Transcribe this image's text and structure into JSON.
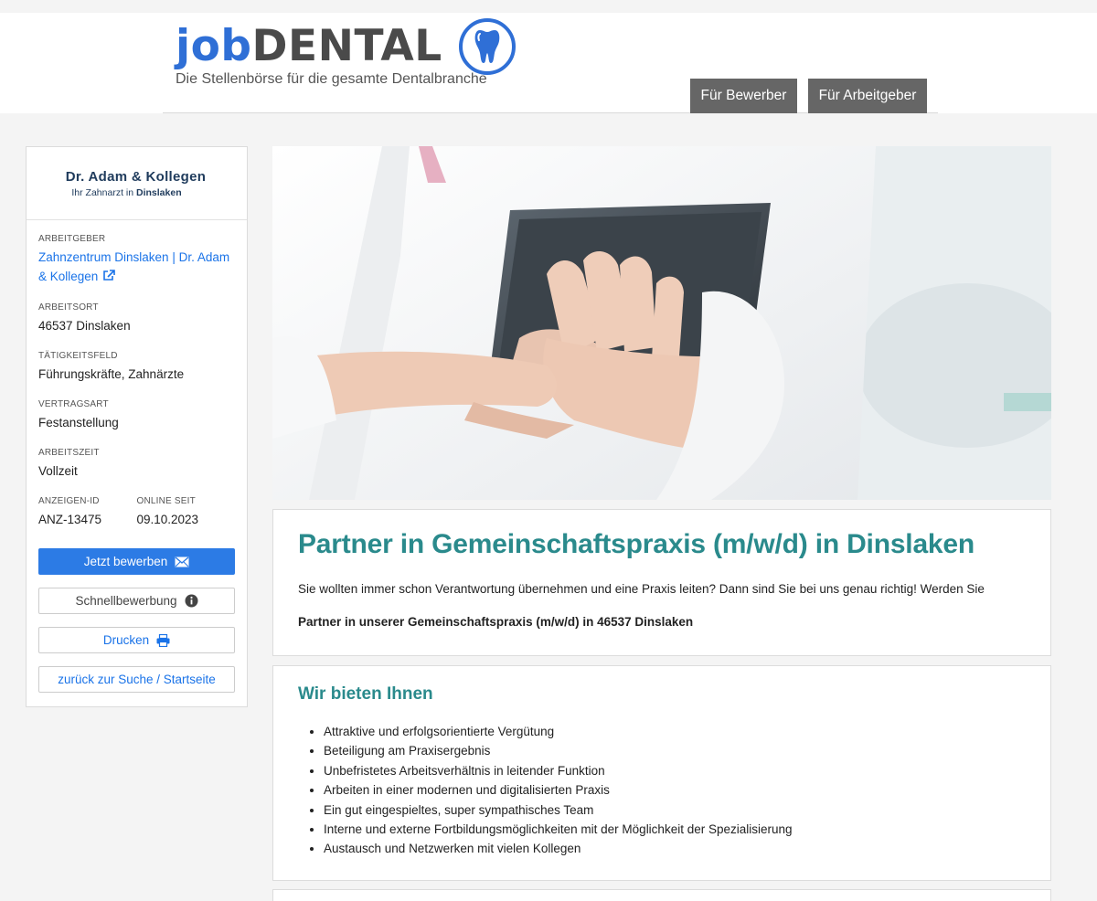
{
  "header": {
    "logo_job": "job",
    "logo_dental": "DENTAL",
    "tagline": "Die Stellenbörse für die gesamte Dentalbranche",
    "nav": {
      "bewerber": "Für Bewerber",
      "arbeitgeber": "Für Arbeitgeber"
    }
  },
  "sidebar": {
    "company_logo_line1": "Dr. Adam & Kollegen",
    "company_logo_line2_prefix": "Ihr Zahnarzt in",
    "company_logo_line2_city": "Dinslaken",
    "fields": {
      "arbeitgeber_label": "ARBEITGEBER",
      "arbeitgeber_value": "Zahnzentrum Dinslaken | Dr. Adam & Kollegen",
      "arbeitsort_label": "ARBEITSORT",
      "arbeitsort_value": "46537 Dinslaken",
      "taetigkeitsfeld_label": "TÄTIGKEITSFELD",
      "taetigkeitsfeld_value": "Führungskräfte, Zahnärzte",
      "vertragsart_label": "VERTRAGSART",
      "vertragsart_value": "Festanstellung",
      "arbeitszeit_label": "ARBEITSZEIT",
      "arbeitszeit_value": "Vollzeit",
      "anzeigen_id_label": "ANZEIGEN-ID",
      "anzeigen_id_value": "ANZ-13475",
      "online_seit_label": "ONLINE SEIT",
      "online_seit_value": "09.10.2023"
    },
    "buttons": {
      "apply": "Jetzt bewerben",
      "quick_apply": "Schnellbewerbung",
      "print": "Drucken",
      "back": "zurück zur Suche / Startseite"
    }
  },
  "job": {
    "title": "Partner in Gemeinschaftspraxis (m/w/d) in Dinslaken",
    "intro": "Sie wollten immer schon Verantwortung übernehmen und eine Praxis leiten? Dann sind Sie bei uns genau richtig! Werden Sie",
    "intro_bold": "Partner in unserer Gemeinschaftspraxis (m/w/d) in 46537 Dinslaken"
  },
  "offer": {
    "title": "Wir bieten Ihnen",
    "items": [
      "Attraktive und erfolgsorientierte Vergütung",
      "Beteiligung am Praxisergebnis",
      "Unbefristetes Arbeitsverhältnis in leitender Funktion",
      "Arbeiten in einer modernen und digitalisierten Praxis",
      "Ein gut eingespieltes, super sympathisches Team",
      "Interne und externe Fortbildungsmöglichkeiten mit der Möglichkeit der Spezialisierung",
      "Austausch und Netzwerken mit vielen Kollegen"
    ]
  },
  "colors": {
    "brand_blue": "#2f6fd6",
    "teal_heading": "#2a8a8c",
    "button_blue": "#2c7be5",
    "nav_gray": "#666666"
  },
  "icons": [
    "tooth-icon",
    "external-link-icon",
    "envelope-icon",
    "info-icon",
    "printer-icon"
  ]
}
